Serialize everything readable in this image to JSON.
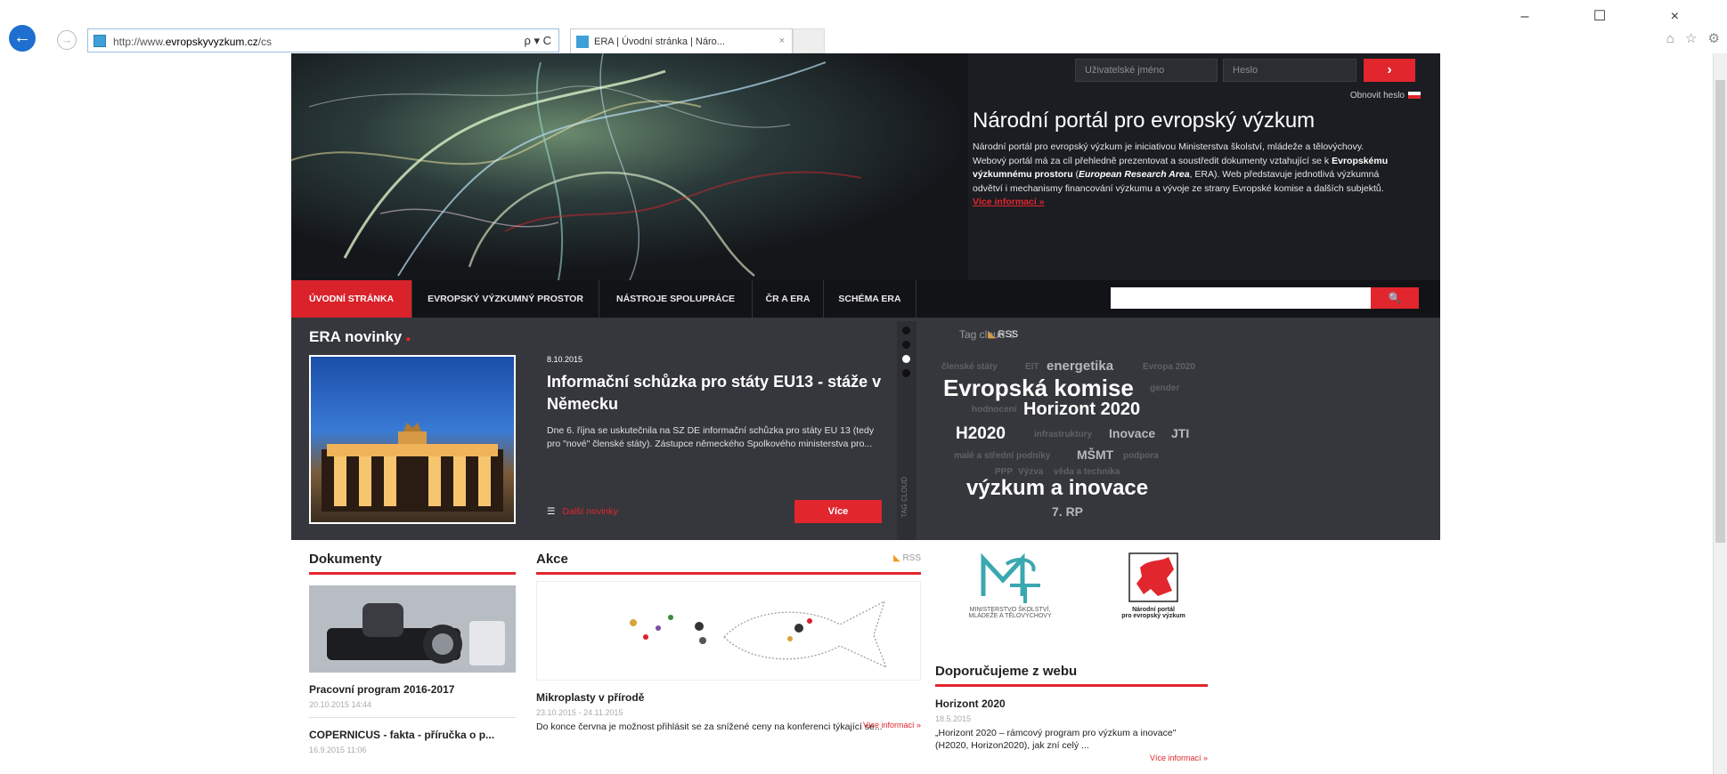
{
  "browser": {
    "url_prefix": "http://www.",
    "url_domain": "evropskyvyzkum.cz",
    "url_path": "/cs",
    "address_tools": "ρ ▾ C",
    "tab_title": "ERA | Úvodní stránka | Náro...",
    "tab_close": "×",
    "window_controls": "– ☐ ×",
    "right_icons": "⌂ ☆ ⚙"
  },
  "header": {
    "username_placeholder": "Uživatelské jméno",
    "password_placeholder": "Heslo",
    "login_button": "›",
    "forgot_password": "Obnovit heslo",
    "title": "Národní portál pro evropský výzkum",
    "intro_1": "Národní portál pro evropský výzkum je iniciativou Ministerstva školství, mládeže a tělovýchovy. Webový portál má za cíl přehledně prezentovat a soustředit dokumenty vztahující se k ",
    "intro_bold": "Evropskému výzkumnému prostoru",
    "intro_2": " (",
    "intro_italic": "European Research Area",
    "intro_3": ", ERA). Web představuje jednotlivá výzkumná odvětví i mechanismy financování výzkumu a vývoje ze strany Evropské komise a dalších subjektů.",
    "more": "Více informací »"
  },
  "nav": {
    "items": [
      {
        "label": "ÚVODNÍ STRÁNKA"
      },
      {
        "label": "EVROPSKÝ VÝZKUMNÝ PROSTOR"
      },
      {
        "label": "NÁSTROJE SPOLUPRÁCE"
      },
      {
        "label": "ČR A ERA"
      },
      {
        "label": "SCHÉMA ERA"
      }
    ],
    "search_button": "🔍"
  },
  "news": {
    "heading": "ERA novinky",
    "heading_mark": "●",
    "rss_icon": "◣",
    "rss": "RSS",
    "date": "8.10.2015",
    "title": "Informační schůzka pro státy EU13 - stáže v Německu",
    "body": "Dne 6. října se uskutečnila na SZ DE informační schůzka pro státy EU 13 (tedy pro \"nové\" členské státy). Zástupce německého Spolkového ministerstva pro...",
    "list_icon": "☰",
    "more_news": "Další novinky",
    "more_button": "Více",
    "slider_label": "TAG CLOUD"
  },
  "tagcloud": {
    "heading": "Tag cloud ⇧",
    "tags": [
      {
        "text": "členské státy"
      },
      {
        "text": "EIT"
      },
      {
        "text": "energetika"
      },
      {
        "text": "Evropa 2020"
      },
      {
        "text": "Evropská komise"
      },
      {
        "text": "gender"
      },
      {
        "text": "hodnocení"
      },
      {
        "text": "Horizont 2020"
      },
      {
        "text": "H2020"
      },
      {
        "text": "infrastruktury"
      },
      {
        "text": "Inovace"
      },
      {
        "text": "JTI"
      },
      {
        "text": "malé a střední podniky"
      },
      {
        "text": "MŠMT"
      },
      {
        "text": "podpora"
      },
      {
        "text": "PPP"
      },
      {
        "text": "Výzva"
      },
      {
        "text": "věda a technika"
      },
      {
        "text": "výzkum a inovace"
      },
      {
        "text": "7. RP"
      }
    ]
  },
  "documents": {
    "heading": "Dokumenty",
    "items": [
      {
        "title": "Pracovní program 2016-2017",
        "date": "20.10.2015 14:44"
      },
      {
        "title": "COPERNICUS - fakta - příručka o p...",
        "date": "16.9.2015 11:06"
      }
    ]
  },
  "events": {
    "heading": "Akce",
    "rss_icon": "◣",
    "rss": "RSS",
    "title": "Mikroplasty v přírodě",
    "date": "23.10.2015 - 24.11.2015",
    "body": "Do konce června je možnost přihlásit se za snížené ceny na konferenci týkající se...",
    "more": "Více informací »"
  },
  "recommend": {
    "logo1_caption": "MINISTERSTVO ŠKOLSTVÍ, MLÁDEŽE A TĚLOVÝCHOVY",
    "logo2_caption_1": "Národní portál",
    "logo2_caption_2": "pro evropský výzkum",
    "heading": "Doporučujeme z webu",
    "title": "Horizont 2020",
    "date": "18.5.2015",
    "body": "„Horizont 2020 – rámcový program pro výzkum a inovace\" (H2020, Horizon2020), jak zní celý ...",
    "more": "Více informací »"
  }
}
